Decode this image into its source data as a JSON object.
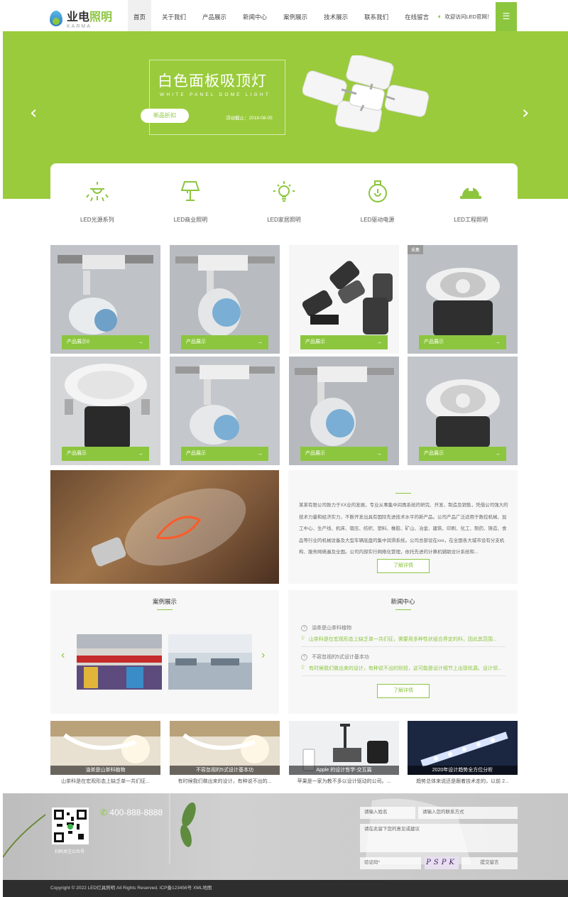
{
  "header": {
    "logo_cn": "业电",
    "logo_cn_green": "照明",
    "logo_en": "KARMA",
    "nav": [
      "首页",
      "关于我们",
      "产品展示",
      "新闻中心",
      "案例展示",
      "技术展示",
      "联系我们",
      "在线留言"
    ],
    "welcome": "欢迎访问LED官网！",
    "menu_icon": "menu-icon"
  },
  "banner": {
    "title": "白色面板吸顶灯",
    "subtitle": "WHITE PANEL DOME LIGHT",
    "button": "新品折扣",
    "date": "活动截止：2018-08-05",
    "prev": "‹",
    "next": "›"
  },
  "categories": [
    {
      "label": "LED光源系列",
      "icon": "ceiling-light-icon"
    },
    {
      "label": "LED商业照明",
      "icon": "table-lamp-icon"
    },
    {
      "label": "LED家居照明",
      "icon": "bulb-icon"
    },
    {
      "label": "LED驱动电源",
      "icon": "power-bulb-icon"
    },
    {
      "label": "LED工程照明",
      "icon": "hard-hat-icon"
    }
  ],
  "products": {
    "labels": [
      "产品展示0",
      "产品展示",
      "产品展示",
      "产品展示",
      "产品展示",
      "产品展示",
      "产品展示",
      "产品展示"
    ],
    "tag": "采集"
  },
  "about": {
    "text": "某某有限公司致力于XX业的发展，专业从事集中间再系统的研究、开发、制造及销售，凭借公司强大的技术力量和经济实力，不断开发出具有国际先进技术水平的新产品。公司产品广泛适用于数控机械、加工中心、生产线、机床、锻压、纺织、塑料、橡胶、矿山、冶金、建筑、印刷、化工、制药、铸造、食品等行业的机械设备及大型车辆底盘的集中润滑系统。公司总部设在xxx，在全国各大城市设有分支机构、服务网络遍及全国。公司内部实行网络化管理，依托先进的计算机辅助设计系统和...",
    "button": "了解详情"
  },
  "cases": {
    "title": "案例展示",
    "prev": "‹",
    "next": "›"
  },
  "news": {
    "title": "新闻中心",
    "items": [
      {
        "q": "油茶是山茶科植物",
        "a": "山茶科是在宏观形态上缺乏单一共们征，需要用多种性状组合界定的科，因此其范围..."
      },
      {
        "q": "不容忽视的5式设计基本功",
        "a": "有时候我们做出来的设计，有种说不出的别扭，这可能是设计细节上出现纰漏。设计领..."
      }
    ],
    "button": "了解详情"
  },
  "news_cards": [
    {
      "caption": "油茶是山茶科植物",
      "desc": "山茶科是在宏观形态上缺乏单一共们征..."
    },
    {
      "caption": "不容忽视的5式设计基本功",
      "desc": "有时候我们做出来的设计，有种说不出的..."
    },
    {
      "caption": "Apple 的设计哲学-交互篇",
      "desc": "苹果是一家为教不多以设计驱动的公司。..."
    },
    {
      "caption": "2020年设计趋势全方位分析",
      "desc": "趋势总体来说还是跟着技术走的，以前 2..."
    }
  ],
  "footer": {
    "qr_label": "扫码关注公众号",
    "phone": "400-888-8888",
    "name_placeholder": "请输入姓名",
    "contact_placeholder": "请输入您的联系方式",
    "message_placeholder": "请在此留下您的意见或建议",
    "captcha_placeholder": "验证码*",
    "captcha": "PSPK",
    "submit": "提交留言",
    "copyright": "Copyright © 2022 LED灯具照明 All Rights Reserved. ICP备123456号 XML地图"
  }
}
